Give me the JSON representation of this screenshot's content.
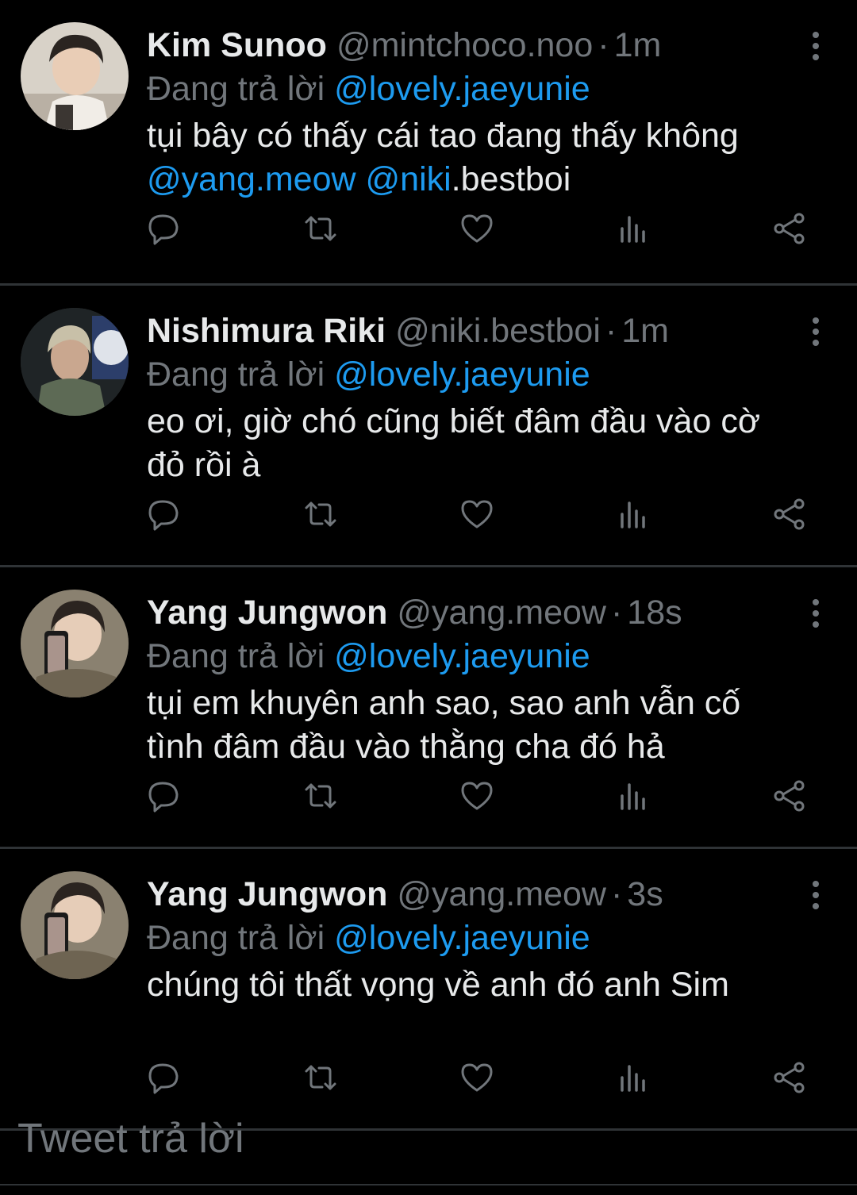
{
  "tweets": [
    {
      "name": "Kim Sunoo",
      "handle": "@mintchoco.noo",
      "separator": "·",
      "time": "1m",
      "replying_prefix": "Đang trả lời",
      "replying_to": "@lovely.jaeyunie",
      "line1": "tụi bây có thấy cái tao đang thấy không",
      "mention_a": "@yang.meow",
      "mention_b": "@niki",
      "tail": ".bestboi",
      "avatar_icon": "avatar-photo"
    },
    {
      "name": "Nishimura Riki",
      "handle": "@niki.bestboi",
      "separator": "·",
      "time": "1m",
      "replying_prefix": "Đang trả lời",
      "replying_to": "@lovely.jaeyunie",
      "line1": "eo ơi, giờ chó cũng biết đâm đầu vào cờ",
      "line2": "đỏ rồi à",
      "avatar_icon": "avatar-photo"
    },
    {
      "name": "Yang Jungwon",
      "handle": "@yang.meow",
      "separator": "·",
      "time": "18s",
      "replying_prefix": "Đang trả lời",
      "replying_to": "@lovely.jaeyunie",
      "line1": "tụi em khuyên anh sao, sao anh vẫn cố",
      "line2": "tình đâm đầu vào thằng cha đó hả",
      "avatar_icon": "avatar-photo"
    },
    {
      "name": "Yang Jungwon",
      "handle": "@yang.meow",
      "separator": "·",
      "time": "3s",
      "replying_prefix": "Đang trả lời",
      "replying_to": "@lovely.jaeyunie",
      "line1": "chúng tôi thất vọng về anh đó anh Sim",
      "avatar_icon": "avatar-photo"
    }
  ],
  "actions": [
    "reply-icon",
    "retweet-icon",
    "like-icon",
    "analytics-icon",
    "share-icon"
  ],
  "reply_box": {
    "placeholder": "Tweet trả lời"
  },
  "colors": {
    "background": "#000000",
    "text": "#e7e9ea",
    "secondary": "#71767b",
    "accent": "#1d9bf0",
    "divider": "#2f3336"
  }
}
